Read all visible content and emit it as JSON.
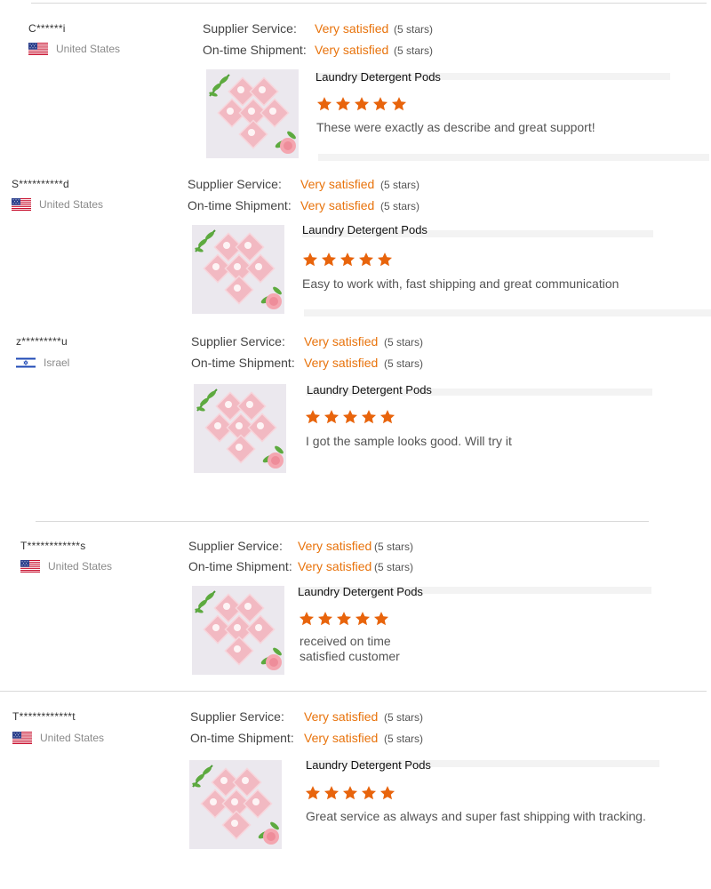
{
  "labels": {
    "supplier_service": "Supplier Service:",
    "ontime_shipment": "On-time Shipment:",
    "rating_text": "Very satisfied",
    "stars_text": "(5 stars)"
  },
  "colors": {
    "accent": "#e8730c",
    "star": "#e8640c",
    "divider": "#d9d9d9"
  },
  "reviews": [
    {
      "buyer": "C******i",
      "country": "United States",
      "flag_icon": "us-flag-icon",
      "product": "Laundry Detergent Pods",
      "star_rating": 5,
      "comment": "These were exactly as describe and great support!"
    },
    {
      "buyer": "S**********d",
      "country": "United States",
      "flag_icon": "us-flag-icon",
      "product": "Laundry Detergent Pods",
      "star_rating": 5,
      "comment": "Easy to work with, fast shipping and great communication"
    },
    {
      "buyer": "z*********u",
      "country": "Israel",
      "flag_icon": "israel-flag-icon",
      "product": "Laundry Detergent Pods",
      "star_rating": 5,
      "comment": "I got the sample looks good. Will try it"
    },
    {
      "buyer": "T************s",
      "country": "United States",
      "flag_icon": "us-flag-icon",
      "product": "Laundry Detergent Pods",
      "star_rating": 5,
      "comment_line1": "received on time",
      "comment_line2": "satisfied customer"
    },
    {
      "buyer": "T************t",
      "country": "United States",
      "flag_icon": "us-flag-icon",
      "product": "Laundry Detergent Pods",
      "star_rating": 5,
      "comment": "Great service as always and super fast shipping with tracking."
    }
  ]
}
